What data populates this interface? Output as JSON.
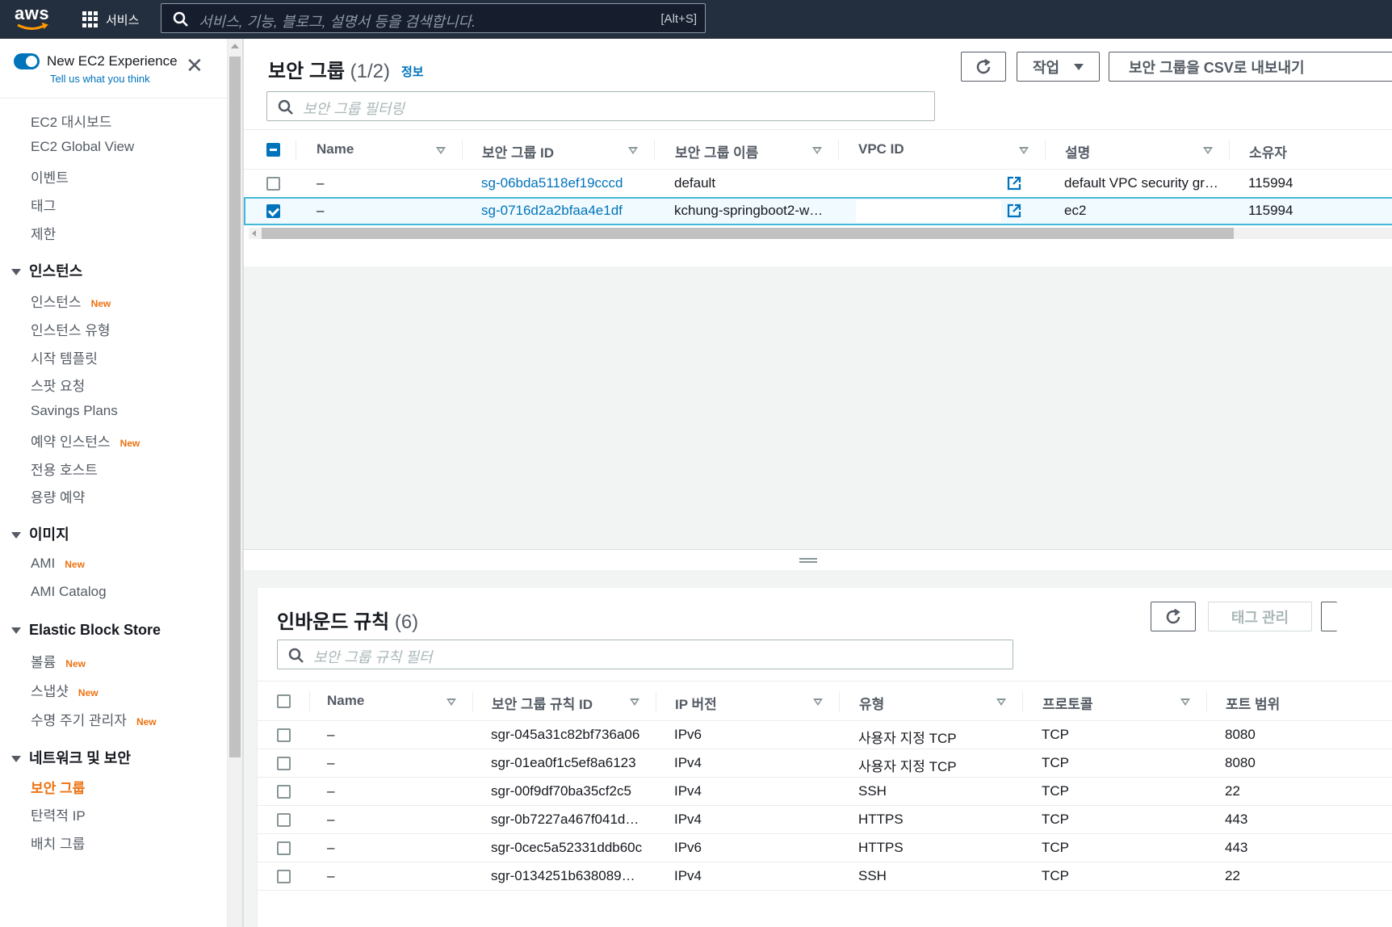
{
  "topbar": {
    "logo_text": "aws",
    "services_label": "서비스",
    "search_placeholder": "서비스, 기능, 블로그, 설명서 등을 검색합니다.",
    "search_shortcut": "[Alt+S]"
  },
  "sidebar": {
    "new_experience_title": "New EC2 Experience",
    "new_experience_sub": "Tell us what you think",
    "top_items": [
      "EC2 대시보드",
      "EC2 Global View",
      "이벤트",
      "태그",
      "제한"
    ],
    "new_badge": "New",
    "sections": [
      {
        "title": "인스턴스",
        "items": [
          {
            "label": "인스턴스",
            "new": true
          },
          {
            "label": "인스턴스 유형",
            "new": false
          },
          {
            "label": "시작 템플릿",
            "new": false
          },
          {
            "label": "스팟 요청",
            "new": false
          },
          {
            "label": "Savings Plans",
            "new": false
          },
          {
            "label": "예약 인스턴스",
            "new": true
          },
          {
            "label": "전용 호스트",
            "new": false
          },
          {
            "label": "용량 예약",
            "new": false
          }
        ]
      },
      {
        "title": "이미지",
        "items": [
          {
            "label": "AMI",
            "new": true
          },
          {
            "label": "AMI Catalog",
            "new": false
          }
        ]
      },
      {
        "title": "Elastic Block Store",
        "items": [
          {
            "label": "볼륨",
            "new": true
          },
          {
            "label": "스냅샷",
            "new": true
          },
          {
            "label": "수명 주기 관리자",
            "new": true
          }
        ]
      },
      {
        "title": "네트워크 및 보안",
        "items": [
          {
            "label": "보안 그룹",
            "new": false,
            "active": true
          },
          {
            "label": "탄력적 IP",
            "new": false
          },
          {
            "label": "배치 그룹",
            "new": false
          }
        ]
      }
    ]
  },
  "security_groups": {
    "title": "보안 그룹",
    "count": "(1/2)",
    "info_link": "정보",
    "refresh_icon": "refresh-icon",
    "actions_label": "작업",
    "export_label": "보안 그룹을 CSV로 내보내기",
    "filter_placeholder": "보안 그룹 필터링",
    "columns": [
      "Name",
      "보안 그룹 ID",
      "보안 그룹 이름",
      "VPC ID",
      "설명",
      "소유자"
    ],
    "rows": [
      {
        "selected": false,
        "name": "–",
        "id": "sg-06bda5118ef19cccd",
        "group_name": "default",
        "vpc_id": "",
        "description": "default VPC security gr…",
        "owner": "115994"
      },
      {
        "selected": true,
        "name": "–",
        "id": "sg-0716d2a2bfaa4e1df",
        "group_name": "kchung-springboot2-w…",
        "vpc_id": "",
        "description": "ec2",
        "owner": "115994"
      }
    ]
  },
  "inbound_rules": {
    "title": "인바운드 규칙",
    "count": "(6)",
    "manage_tags_label": "태그 관리",
    "filter_placeholder": "보안 그룹 규칙 필터",
    "columns": [
      "Name",
      "보안 그룹 규칙 ID",
      "IP 버전",
      "유형",
      "프로토콜",
      "포트 범위"
    ],
    "rows": [
      {
        "name": "–",
        "rule_id": "sgr-045a31c82bf736a06",
        "ip_version": "IPv6",
        "type": "사용자 지정 TCP",
        "protocol": "TCP",
        "port": "8080"
      },
      {
        "name": "–",
        "rule_id": "sgr-01ea0f1c5ef8a6123",
        "ip_version": "IPv4",
        "type": "사용자 지정 TCP",
        "protocol": "TCP",
        "port": "8080"
      },
      {
        "name": "–",
        "rule_id": "sgr-00f9df70ba35cf2c5",
        "ip_version": "IPv4",
        "type": "SSH",
        "protocol": "TCP",
        "port": "22"
      },
      {
        "name": "–",
        "rule_id": "sgr-0b7227a467f041d…",
        "ip_version": "IPv4",
        "type": "HTTPS",
        "protocol": "TCP",
        "port": "443"
      },
      {
        "name": "–",
        "rule_id": "sgr-0cec5a52331ddb60c",
        "ip_version": "IPv6",
        "type": "HTTPS",
        "protocol": "TCP",
        "port": "443"
      },
      {
        "name": "–",
        "rule_id": "sgr-0134251b638089…",
        "ip_version": "IPv4",
        "type": "SSH",
        "protocol": "TCP",
        "port": "22"
      }
    ]
  },
  "colors": {
    "topbar": "#232f3e",
    "link": "#0073bb",
    "accent": "#ec7211",
    "selected_border": "#44b9d6"
  }
}
